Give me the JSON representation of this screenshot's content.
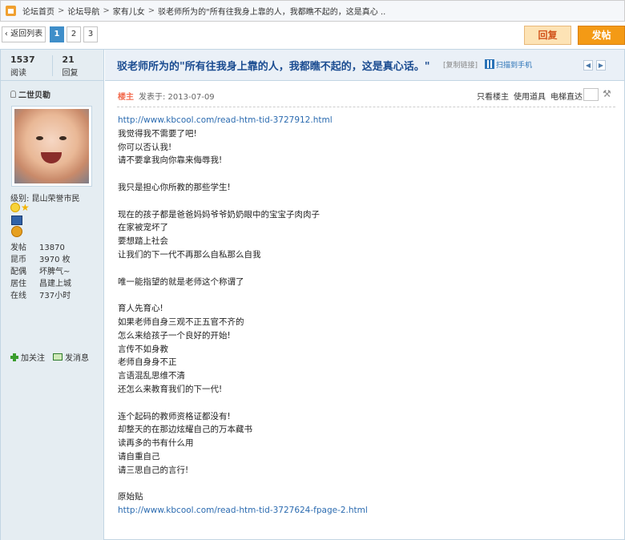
{
  "breadcrumb": {
    "items": [
      "论坛首页",
      "论坛导航",
      "家有儿女",
      "驳老师所为的\"所有往我身上靠的人，我都瞧不起的，这是真心 .."
    ]
  },
  "pager": {
    "back_label": "返回列表",
    "pages": [
      "1",
      "2",
      "3"
    ],
    "current_page": "1",
    "reply_label": "回复",
    "post_label": "发帖"
  },
  "stats": {
    "views_num": "1537",
    "views_label": "阅读",
    "replies_num": "21",
    "replies_label": "回复"
  },
  "thread": {
    "title": "驳老师所为的\"所有往我身上靠的人，我都瞧不起的，这是真心话。\"",
    "copy_link": "[复制链接]",
    "scan_label": "扫描到手机"
  },
  "author": {
    "name": "二世贝勒",
    "level": "级别: 昆山荣誉市民",
    "profile": [
      {
        "key": "发帖",
        "value": "13870"
      },
      {
        "key": "昆币",
        "value": "3970 枚"
      },
      {
        "key": "配偶",
        "value": "坏脾气~"
      },
      {
        "key": "居住",
        "value": "昌建上城"
      },
      {
        "key": "在线",
        "value": "737小时"
      }
    ],
    "follow_label": "加关注",
    "message_label": "发消息"
  },
  "post": {
    "op_badge": "楼主",
    "posted_at": "发表于: 2013-07-09",
    "only_op": "只看楼主",
    "use_tool": "使用道具",
    "elevator": "电梯直达",
    "lines": [
      {
        "text": "http://www.kbcool.com/read-htm-tid-3727912.html",
        "link": true
      },
      {
        "text": "我觉得我不需要了吧!",
        "link": false
      },
      {
        "text": "你可以否认我!",
        "link": false
      },
      {
        "text": "请不要拿我向你靠来侮辱我!",
        "link": false
      },
      {
        "text": "",
        "link": false
      },
      {
        "text": "我只是担心你所教的那些学生!",
        "link": false
      },
      {
        "text": "",
        "link": false
      },
      {
        "text": "现在的孩子都是爸爸妈妈爷爷奶奶眼中的宝宝子肉肉子",
        "link": false
      },
      {
        "text": "在家被宠坏了",
        "link": false
      },
      {
        "text": "要想踏上社会",
        "link": false
      },
      {
        "text": "让我们的下一代不再那么自私那么自我",
        "link": false
      },
      {
        "text": "",
        "link": false
      },
      {
        "text": "唯一能指望的就是老师这个称谓了",
        "link": false
      },
      {
        "text": "",
        "link": false
      },
      {
        "text": "育人先育心!",
        "link": false
      },
      {
        "text": "如果老师自身三观不正五官不齐的",
        "link": false
      },
      {
        "text": "怎么来给孩子一个良好的开始!",
        "link": false
      },
      {
        "text": "言传不如身教",
        "link": false
      },
      {
        "text": "老师自身身不正",
        "link": false
      },
      {
        "text": "言语混乱思维不清",
        "link": false
      },
      {
        "text": "还怎么来教育我们的下一代!",
        "link": false
      },
      {
        "text": "",
        "link": false
      },
      {
        "text": "连个起码的教师资格证都没有!",
        "link": false
      },
      {
        "text": "却整天的在那边炫耀自己的万本藏书",
        "link": false
      },
      {
        "text": "读再多的书有什么用",
        "link": false
      },
      {
        "text": "请自重自己",
        "link": false
      },
      {
        "text": "请三思自己的言行!",
        "link": false
      },
      {
        "text": "",
        "link": false
      },
      {
        "text": "原始贴",
        "link": false
      },
      {
        "text": "http://www.kbcool.com/read-htm-tid-3727624-fpage-2.html",
        "link": true
      }
    ]
  },
  "colors": {
    "accent_blue": "#1b4c91",
    "link_blue": "#2b6bb0",
    "post_button": "#f49a15",
    "reply_button": "#fde3b5",
    "sidebar_bg": "#e5edf2"
  },
  "icons": [
    "home-icon",
    "user-icon",
    "smile-icon",
    "star-icon",
    "medal-icon",
    "plus-icon",
    "message-icon",
    "qr-code-icon",
    "wrench-icon"
  ]
}
